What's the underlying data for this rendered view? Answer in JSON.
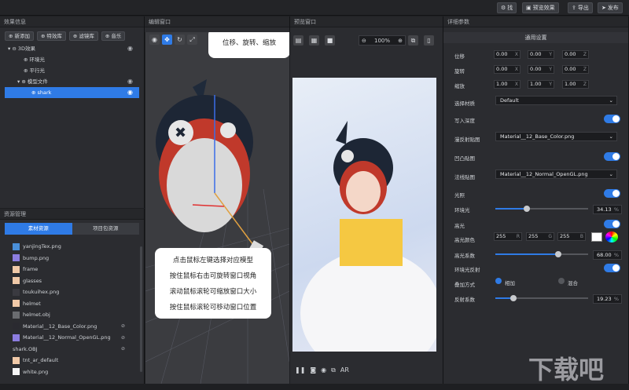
{
  "topbar": {
    "find_label": "找",
    "preview_label": "预览效果",
    "export_label": "导出",
    "publish_label": "发布"
  },
  "effects_panel": {
    "title": "效果信息",
    "buttons": {
      "add": "新添加",
      "effect_lib": "特效库",
      "filter_lib": "滤镜库",
      "music": "音乐"
    },
    "tree": [
      {
        "label": "3D效果"
      },
      {
        "label": "环境光"
      },
      {
        "label": "平行光"
      },
      {
        "label": "模型文件"
      },
      {
        "label": "shark"
      }
    ]
  },
  "resources_panel": {
    "title": "资源管理",
    "tabs": {
      "material": "素材资源",
      "project": "项目包资源"
    },
    "items": [
      {
        "name": "yanjingTex.png",
        "color": "#4a8fd8"
      },
      {
        "name": "bump.png",
        "color": "#8c7de0"
      },
      {
        "name": "frame",
        "color": "#f0c9a8"
      },
      {
        "name": "glasses",
        "color": "#f0c9a8"
      },
      {
        "name": "toukuihex.png",
        "color": "#3a3a40"
      },
      {
        "name": "helmet",
        "color": "#f0c9a8"
      },
      {
        "name": "helmet.obj",
        "color": "#6a6c70"
      },
      {
        "name": "Material__12_Base_Color.png",
        "color": "#2a2a30"
      },
      {
        "name": "Material__12_Normal_OpenGL.png",
        "color": "#8c7de0"
      },
      {
        "name": "shark.OBJ",
        "color": ""
      },
      {
        "name": "tnt_ar_default",
        "color": "#f0c9a8"
      },
      {
        "name": "white.png",
        "color": "#f5f5f5"
      }
    ]
  },
  "editor": {
    "title": "编辑窗口",
    "callout_tools": "位移、旋转、缩放",
    "callout_help": [
      "点击鼠标左键选择对应模型",
      "按住鼠标右击可旋转窗口视角",
      "滚动鼠标滚轮可缩放窗口大小",
      "按住鼠标滚轮可移动窗口位置"
    ]
  },
  "preview": {
    "title": "预览窗口",
    "zoom": "100%",
    "ar_label": "AR"
  },
  "details": {
    "title": "详细参数",
    "section": "通用设置",
    "position": {
      "label": "位移",
      "x": "0.00",
      "y": "0.00",
      "z": "0.00"
    },
    "rotation": {
      "label": "旋转",
      "x": "0.00",
      "y": "0.00",
      "z": "0.00"
    },
    "scale": {
      "label": "缩放",
      "x": "1.00",
      "y": "1.00",
      "z": "1.00"
    },
    "axis_x": "X",
    "axis_y": "Y",
    "axis_z": "Z",
    "material_label": "选择材质",
    "material_value": "Default",
    "depth_write": "写入深度",
    "diffuse_map_label": "漫反射贴图",
    "diffuse_map_value": "Material__12_Base_Color.png",
    "bump_label": "凹凸贴图",
    "normal_map_label": "法线贴图",
    "normal_map_value": "Material__12_Normal_OpenGL.png",
    "lighting": "光照",
    "ambient_label": "环境光",
    "ambient_value": "34.13",
    "ambient_fraction": 0.3413,
    "highlight": "高光",
    "highlight_color_label": "高光颜色",
    "r": "255",
    "g": "255",
    "b": "255",
    "r_label": "R",
    "g_label": "G",
    "b_label": "B",
    "highlight_coef_label": "高光系数",
    "highlight_coef_value": "68.00",
    "highlight_fraction": 0.68,
    "env_reflection": "环境光反射",
    "blend_label": "叠加方式",
    "blend_add": "相加",
    "blend_mix": "混合",
    "reflect_coef_label": "反射系数",
    "reflect_coef_value": "19.23",
    "reflect_fraction": 0.1923,
    "percent": "%"
  },
  "watermark": "下载吧",
  "accent_color": "#2f7be6"
}
